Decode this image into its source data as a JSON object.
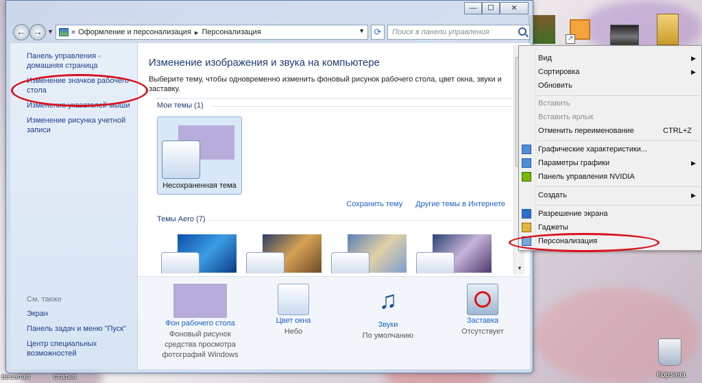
{
  "window": {
    "breadcrumb": [
      "Оформление и персонализация",
      "Персонализация"
    ],
    "breadcrumb_prefix": "«",
    "search_placeholder": "Поиск в панели управления",
    "caption": {
      "minimize": "—",
      "maximize": "☐",
      "close": "✕"
    }
  },
  "sidebar": {
    "items": [
      {
        "label": "Панель управления - домашняя страница"
      },
      {
        "label": "Изменение значков рабочего стола"
      },
      {
        "label": "Изменение указателей мыши"
      },
      {
        "label": "Изменение рисунка учетной записи"
      }
    ],
    "see_also_title": "См. также",
    "see_also": [
      {
        "label": "Экран"
      },
      {
        "label": "Панель задач и меню \"Пуск\""
      },
      {
        "label": "Центр специальных возможностей"
      }
    ]
  },
  "main": {
    "title": "Изменение изображения и звука на компьютере",
    "description": "Выберите тему, чтобы одновременно изменить фоновый рисунок рабочего стола, цвет окна, звуки и заставку.",
    "my_themes_label": "Мои темы (1)",
    "unsaved_theme": "Несохраненная тема",
    "save_theme": "Сохранить тему",
    "more_themes": "Другие темы в Интернете",
    "aero_label": "Темы Aero (7)"
  },
  "bottom": [
    {
      "title": "Фон рабочего стола",
      "subtitle": "Фоновый рисунок средства просмотра фотографий Windows"
    },
    {
      "title": "Цвет окна",
      "subtitle": "Небо"
    },
    {
      "title": "Звуки",
      "subtitle": "По умолчанию"
    },
    {
      "title": "Заставка",
      "subtitle": "Отсутствует"
    }
  ],
  "context_menu": {
    "items": [
      {
        "label": "Вид"
      },
      {
        "label": "Сортировка"
      },
      {
        "label": "Обновить"
      },
      {
        "label": "Вставить"
      },
      {
        "label": "Вставить ярлык"
      },
      {
        "label": "Отменить переименование",
        "shortcut": "CTRL+Z"
      },
      {
        "label": "Графические характеристики..."
      },
      {
        "label": "Параметры графики"
      },
      {
        "label": "Панель управления NVIDIA"
      },
      {
        "label": "Создать"
      },
      {
        "label": "Разрешение экрана"
      },
      {
        "label": "Гаджеты"
      },
      {
        "label": "Персонализация"
      }
    ]
  },
  "desktop": {
    "labels": [
      "веселая",
      "статья",
      "Корзина"
    ]
  },
  "colors": {
    "link": "#1e3f8a",
    "accent_red": "#d8111c",
    "wallpaper_swatch": "#b8acdb"
  }
}
